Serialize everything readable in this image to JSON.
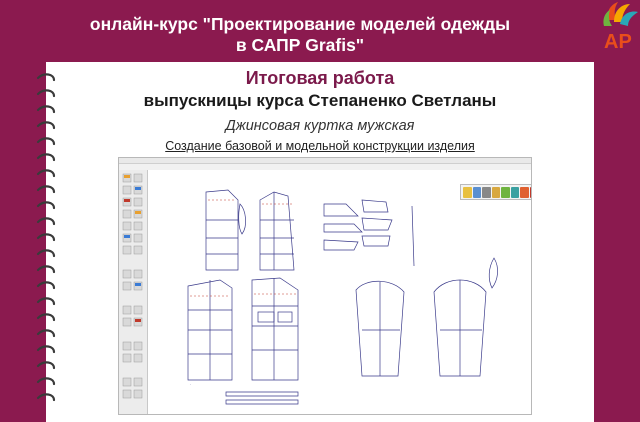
{
  "header": {
    "title_line1": "онлайн-курс \"Проектирование моделей одежды",
    "title_line2": "в САПР Grafis\""
  },
  "logo": {
    "text": "AP",
    "colors": [
      "#e94e1b",
      "#f6a800",
      "#2aa7b7",
      "#6fb43f",
      "#ffffff"
    ]
  },
  "card": {
    "heading": "Итоговая работа",
    "subheading": "выпускницы курса Степаненко Светланы",
    "item": "Джинсовая куртка мужская",
    "description": "Создание базовой и модельной конструкции изделия"
  },
  "app_window": {
    "left_tool_icons": [
      "cursor-icon",
      "line-icon",
      "curve-icon",
      "point-icon",
      "measure-icon",
      "piece-icon",
      "text-icon",
      "grid-icon",
      "layer-icon",
      "zoom-icon",
      "move-icon",
      "rotate-icon",
      "mirror-icon",
      "cut-icon",
      "seam-icon",
      "notch-icon",
      "grain-icon",
      "label-icon",
      "print-icon",
      "export-icon"
    ],
    "floating_toolbar_icons": [
      "save-icon",
      "open-icon",
      "print-icon",
      "folder-icon",
      "zoom-in-icon",
      "zoom-out-icon",
      "fit-icon",
      "color-icon",
      "ok-icon",
      "download-icon"
    ],
    "colors": {
      "accent": "#8b1a4f",
      "pattern_lines": "#3a3a8a",
      "guides": "#c0392b"
    }
  }
}
